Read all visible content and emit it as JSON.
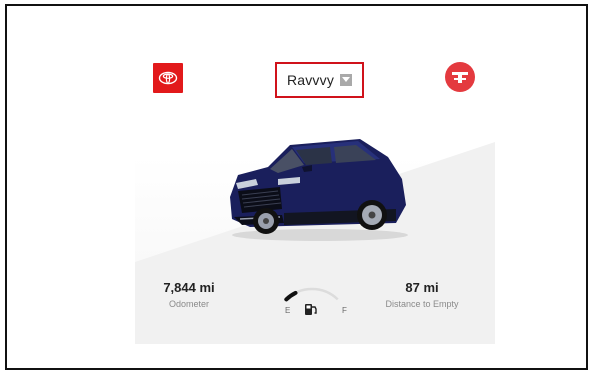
{
  "header": {
    "vehicle_name": "Ravvvy",
    "brand_logo_icon": "toyota-logo-icon",
    "service_icon": "toyota-service-icon",
    "selector_icon": "chevron-down-icon"
  },
  "stats": {
    "odometer_value": "7,844 mi",
    "odometer_label": "Odometer",
    "distance_value": "87 mi",
    "distance_label": "Distance to Empty"
  },
  "fuel_gauge": {
    "empty_label": "E",
    "full_label": "F",
    "fuel_level": 0.2,
    "icon": "fuel-pump-icon"
  },
  "colors": {
    "brand_red": "#e2191b",
    "highlight_border": "#d0121b",
    "car_body": "#1a1f5c"
  }
}
